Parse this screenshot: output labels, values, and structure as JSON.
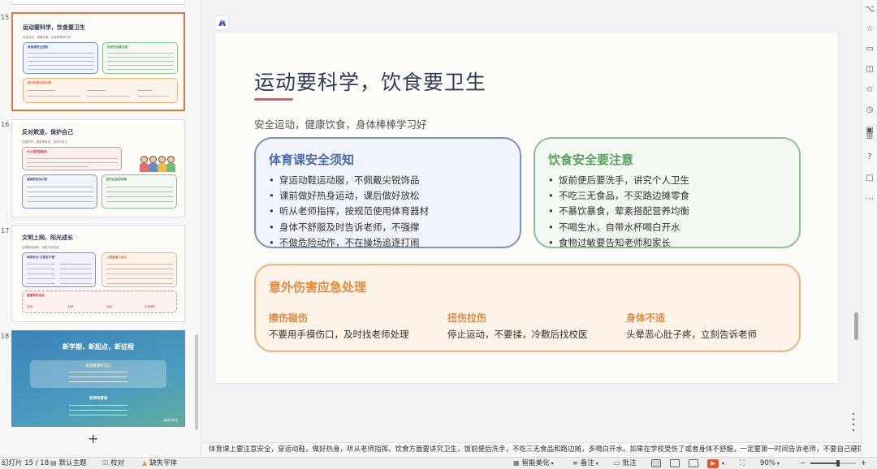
{
  "slides_panel": {
    "thumbnails": [
      {
        "number": "15",
        "title": "运动要科学，饮食要卫生",
        "subtitle": "安全运动，健康饮食，身体棒棒学习好",
        "cards": [
          "体育课安全须知",
          "饮食安全要注意",
          "意外伤害应急处理"
        ]
      },
      {
        "number": "16",
        "title": "反对欺凌，保护自己",
        "subtitle": "友善同学，遇事勇敢说，保护好自己",
        "cards": [
          "什么是校园欺凌",
          "遇到欺凌怎么做",
          "我们应该这样做"
        ]
      },
      {
        "number": "17",
        "title": "文明上网，阳光成长",
        "subtitle": "合理使用网络，远离不良信息",
        "cards": [
          "网络安全\"五要五不要\"",
          "心理健康小贴士",
          "重要联系电话"
        ],
        "phones": [
          "110",
          "119",
          "120",
          "12355"
        ]
      },
      {
        "number": "18",
        "title": "新学期，新起点，新征程",
        "box_title": "安全教育牢记心",
        "sub_title": "老师的寄语",
        "signature": "最美的寄语"
      }
    ],
    "add_label": "+"
  },
  "slide": {
    "title": "运动要科学，饮食要卫生",
    "subtitle": "安全运动，健康饮食，身体棒棒学习好",
    "pe_card": {
      "title": "体育课安全须知",
      "items": [
        "穿运动鞋运动服，不佩戴尖锐饰品",
        "课前做好热身运动，课后做好放松",
        "听从老师指挥，按规范使用体育器材",
        "身体不舒服及时告诉老师，不强撑",
        "不做危险动作，不在操场追逐打闹"
      ]
    },
    "food_card": {
      "title": "饮食安全要注意",
      "items": [
        "饭前便后要洗手，讲究个人卫生",
        "不吃三无食品，不买路边摊零食",
        "不暴饮暴食，荤素搭配营养均衡",
        "不喝生水，自带水杯喝白开水",
        "食物过敏要告知老师和家长"
      ]
    },
    "emergency_card": {
      "title": "意外伤害应急处理",
      "items": [
        {
          "title": "擦伤碰伤",
          "desc": "不要用手摸伤口，及时找老师处理"
        },
        {
          "title": "扭伤拉伤",
          "desc": "停止运动，不要揉，冷敷后找校医"
        },
        {
          "title": "身体不适",
          "desc": "头晕恶心肚子疼，立刻告诉老师"
        }
      ]
    }
  },
  "notes": "体育课上要注意安全，穿运动鞋，做好热身，听从老师指挥。饮食方面要讲究卫生，饭前便后洗手，不吃三无食品和路边摊，多喝白开水。如果在学校受伤了或者身体不舒服，一定要第一时间告诉老师，不要自己硬撑，也不",
  "statusbar": {
    "slide_counter": "幻灯片 15 / 18",
    "theme": "默认主题",
    "proofread": "校对",
    "missing_font": "缺失字体",
    "beautify": "智能美化",
    "notes_btn": "备注",
    "comments_btn": "批注",
    "zoom": "90%",
    "zoom_fraction": 0.6
  },
  "colors": {
    "accent_orange": "#e07a3c",
    "blue_card": "#7a8fc6",
    "green_card": "#88c28c",
    "orange_card": "#efb17c",
    "title_underline": "#d85f5f"
  },
  "icons": {
    "logo": "wps-logo-icon",
    "right_toolbar": [
      "magic-icon",
      "star-icon",
      "comment-icon",
      "layers-icon",
      "star-outline-icon",
      "history-icon",
      "image-icon",
      "puzzle-icon",
      "help-icon",
      "message-icon",
      "more-icon"
    ]
  }
}
